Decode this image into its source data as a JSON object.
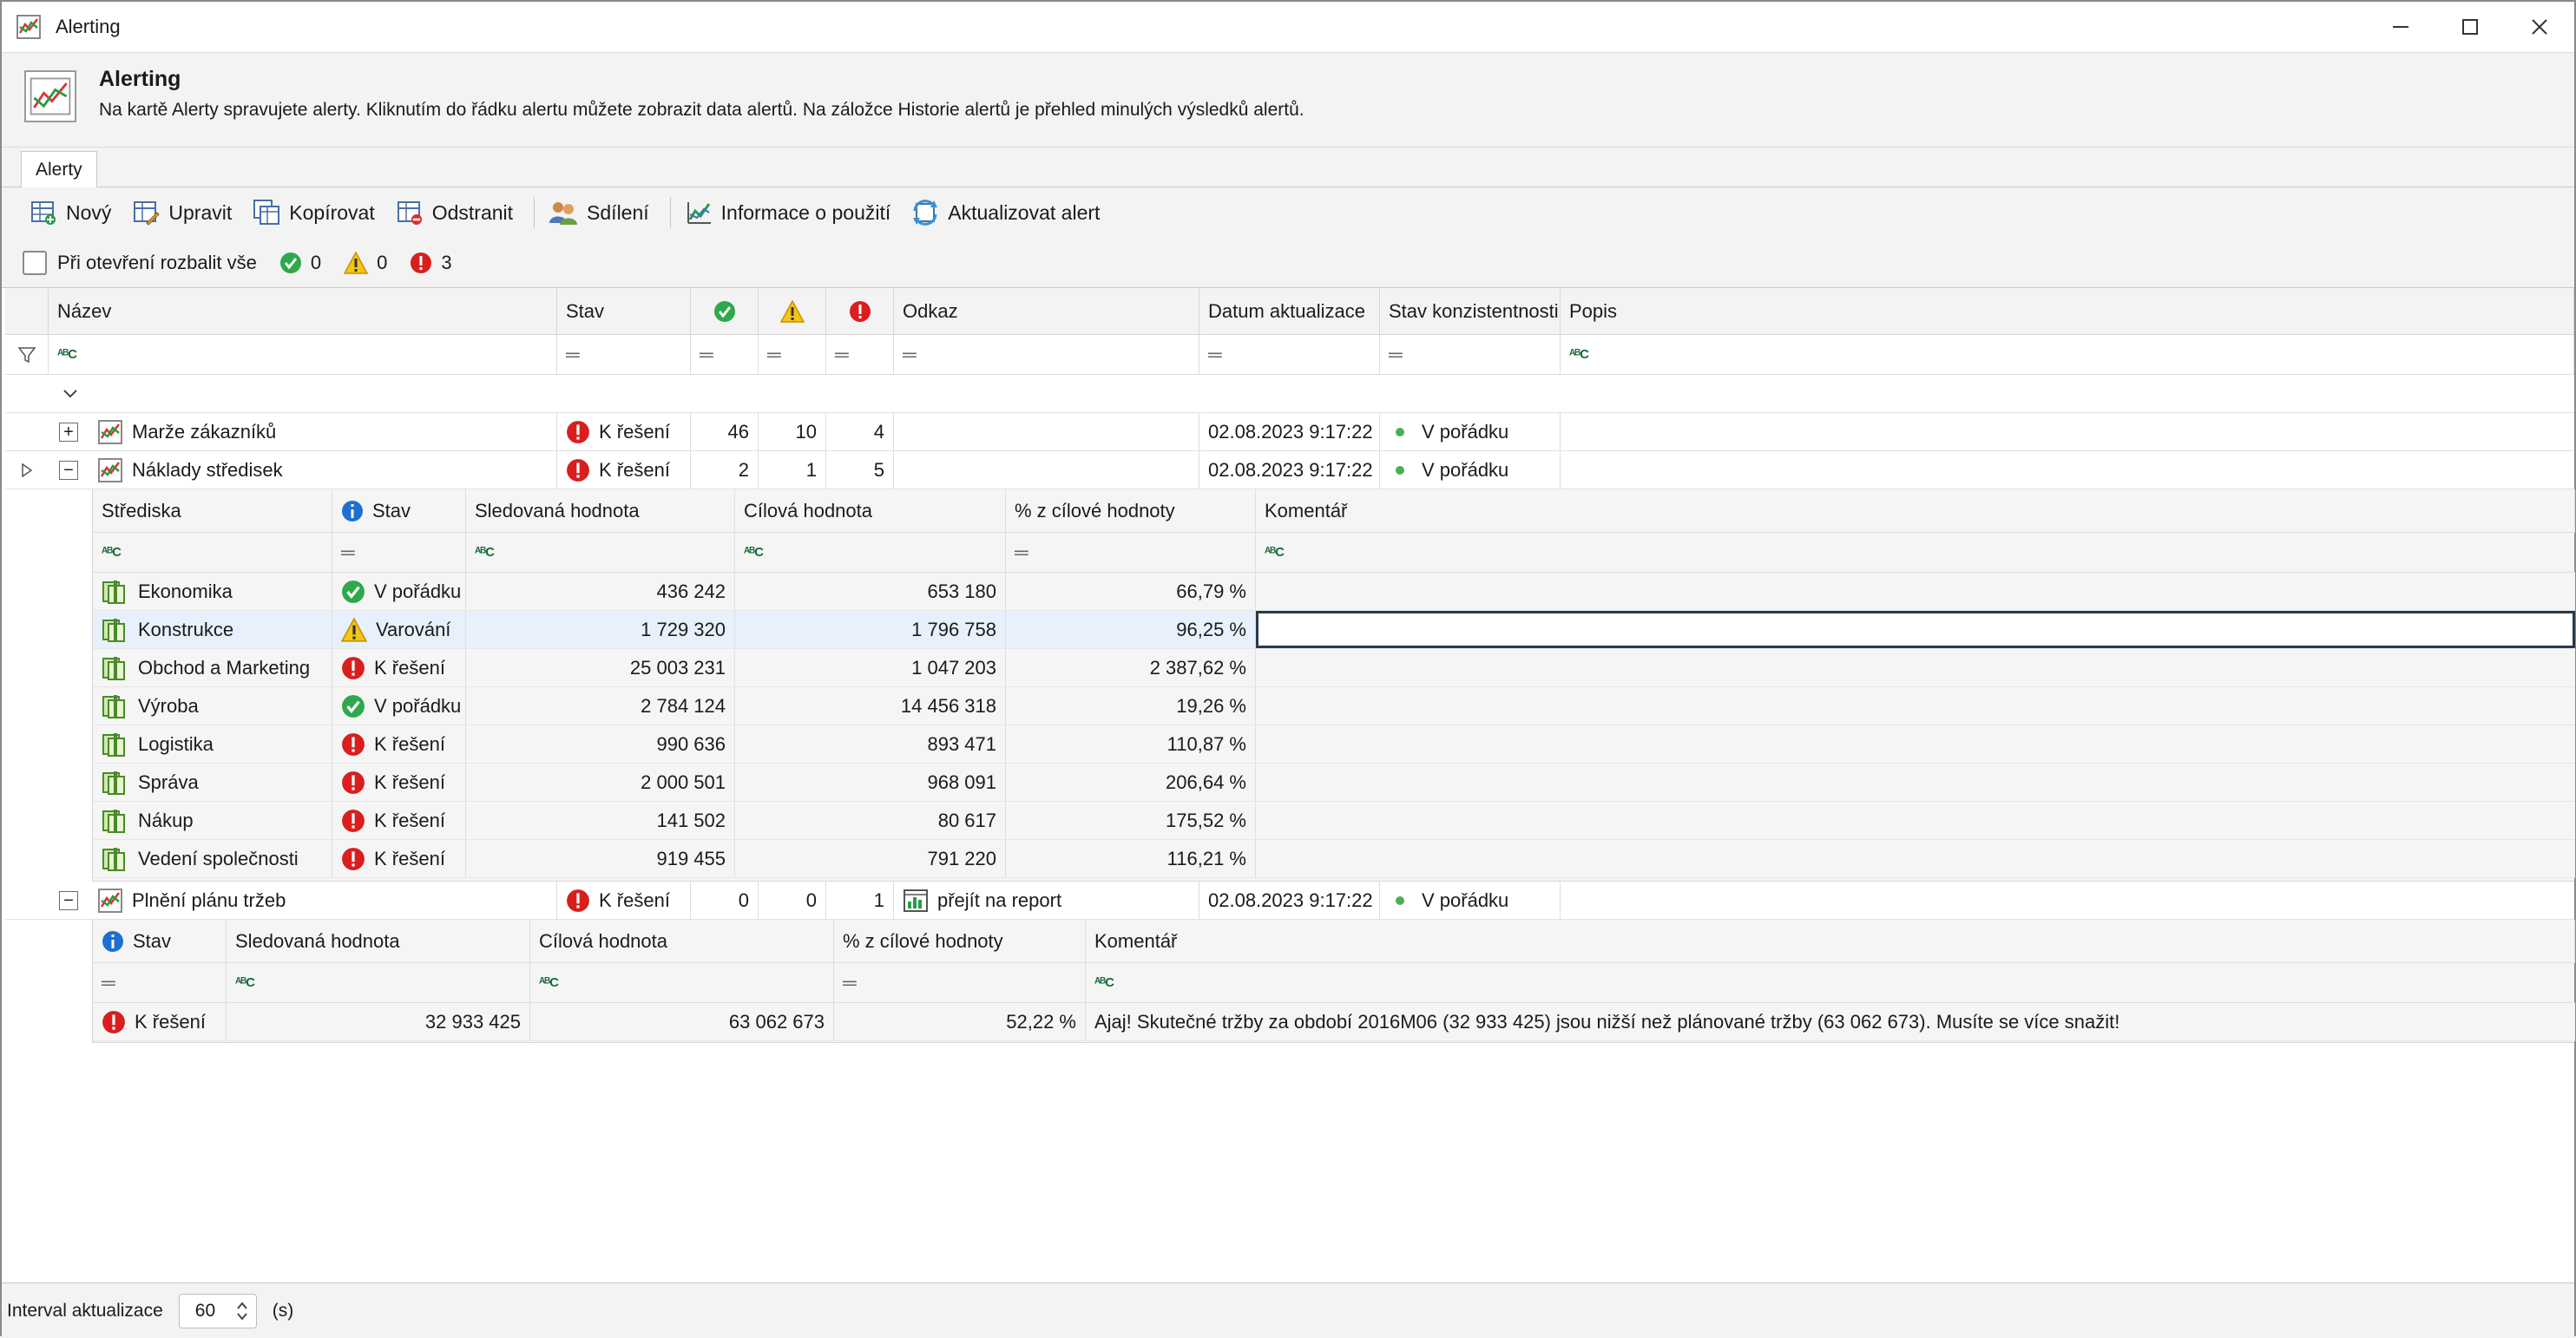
{
  "window": {
    "title": "Alerting"
  },
  "header": {
    "title": "Alerting",
    "description": "Na kartě Alerty spravujete alerty. Kliknutím do řádku alertu můžete zobrazit data alertů. Na záložce Historie alertů je přehled minulých výsledků alertů."
  },
  "tabs": [
    {
      "label": "Alerty"
    }
  ],
  "toolbar": {
    "new_label": "Nový",
    "edit_label": "Upravit",
    "copy_label": "Kopírovat",
    "delete_label": "Odstranit",
    "share_label": "Sdílení",
    "usage_label": "Informace o použití",
    "refresh_label": "Aktualizovat alert"
  },
  "options": {
    "expand_all_label": "Při otevření rozbalit vše",
    "count_ok": "0",
    "count_warning": "0",
    "count_error": "3"
  },
  "grid": {
    "columns": {
      "name": "Název",
      "status": "Stav",
      "link": "Odkaz",
      "updated": "Datum aktualizace",
      "consistency": "Stav konzistentnosti",
      "description": "Popis"
    },
    "rows": [
      {
        "name": "Marže zákazníků",
        "status": "K řešení",
        "ok": "46",
        "warn": "10",
        "err": "4",
        "link": "",
        "updated": "02.08.2023 9:17:22",
        "consistency": "V pořádku"
      },
      {
        "name": "Náklady středisek",
        "status": "K řešení",
        "ok": "2",
        "warn": "1",
        "err": "5",
        "link": "",
        "updated": "02.08.2023 9:17:22",
        "consistency": "V pořádku"
      },
      {
        "name": "Plnění plánu tržeb",
        "status": "K řešení",
        "ok": "0",
        "warn": "0",
        "err": "1",
        "link": "přejít na report",
        "updated": "02.08.2023 9:17:22",
        "consistency": "V pořádku"
      }
    ]
  },
  "detail1": {
    "columns": {
      "center": "Střediska",
      "status": "Stav",
      "tracked": "Sledovaná hodnota",
      "target": "Cílová hodnota",
      "pct": "% z cílové hodnoty",
      "comment": "Komentář"
    },
    "rows": [
      {
        "center": "Ekonomika",
        "status": "V pořádku",
        "kind": "ok",
        "tracked": "436 242",
        "target": "653 180",
        "pct": "66,79 %"
      },
      {
        "center": "Konstrukce",
        "status": "Varování",
        "kind": "warn",
        "tracked": "1 729 320",
        "target": "1 796 758",
        "pct": "96,25 %"
      },
      {
        "center": "Obchod a Marketing",
        "status": "K řešení",
        "kind": "err",
        "tracked": "25 003 231",
        "target": "1 047 203",
        "pct": "2 387,62 %"
      },
      {
        "center": "Výroba",
        "status": "V pořádku",
        "kind": "ok",
        "tracked": "2 784 124",
        "target": "14 456 318",
        "pct": "19,26 %"
      },
      {
        "center": "Logistika",
        "status": "K řešení",
        "kind": "err",
        "tracked": "990 636",
        "target": "893 471",
        "pct": "110,87 %"
      },
      {
        "center": "Správa",
        "status": "K řešení",
        "kind": "err",
        "tracked": "2 000 501",
        "target": "968 091",
        "pct": "206,64 %"
      },
      {
        "center": "Nákup",
        "status": "K řešení",
        "kind": "err",
        "tracked": "141 502",
        "target": "80 617",
        "pct": "175,52 %"
      },
      {
        "center": "Vedení společnosti",
        "status": "K řešení",
        "kind": "err",
        "tracked": "919 455",
        "target": "791 220",
        "pct": "116,21 %"
      }
    ]
  },
  "detail2": {
    "columns": {
      "status": "Stav",
      "tracked": "Sledovaná hodnota",
      "target": "Cílová hodnota",
      "pct": "% z cílové hodnoty",
      "comment": "Komentář"
    },
    "rows": [
      {
        "status": "K řešení",
        "tracked": "32 933 425",
        "target": "63 062 673",
        "pct": "52,22 %",
        "comment": "Ajaj! Skutečné tržby za období 2016M06 (32 933 425) jsou nižší než plánované tržby (63 062 673). Musíte se více snažit!"
      }
    ]
  },
  "statusbar": {
    "interval_label": "Interval aktualizace",
    "interval_value": "60",
    "unit": "(s)"
  }
}
